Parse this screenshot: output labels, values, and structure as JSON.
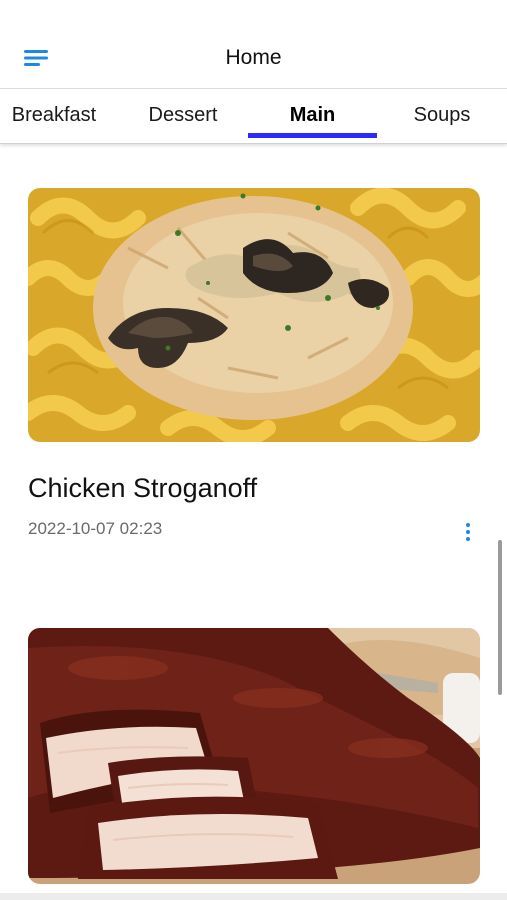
{
  "header": {
    "title": "Home",
    "menu_icon": "hamburger-menu-icon"
  },
  "tabs": [
    {
      "label": "Breakfast",
      "active": false
    },
    {
      "label": "Dessert",
      "active": false
    },
    {
      "label": "Main",
      "active": true
    },
    {
      "label": "Soups",
      "active": false
    }
  ],
  "recipes": [
    {
      "title": "Chicken Stroganoff",
      "date": "2022-10-07 02:23",
      "menu_icon": "more-vertical-icon"
    },
    {
      "image": "bbq-ribs-photo"
    }
  ],
  "colors": {
    "accent": "#1e88e5",
    "tab_indicator": "#2a2aff",
    "date_text": "#6a6a6a"
  }
}
